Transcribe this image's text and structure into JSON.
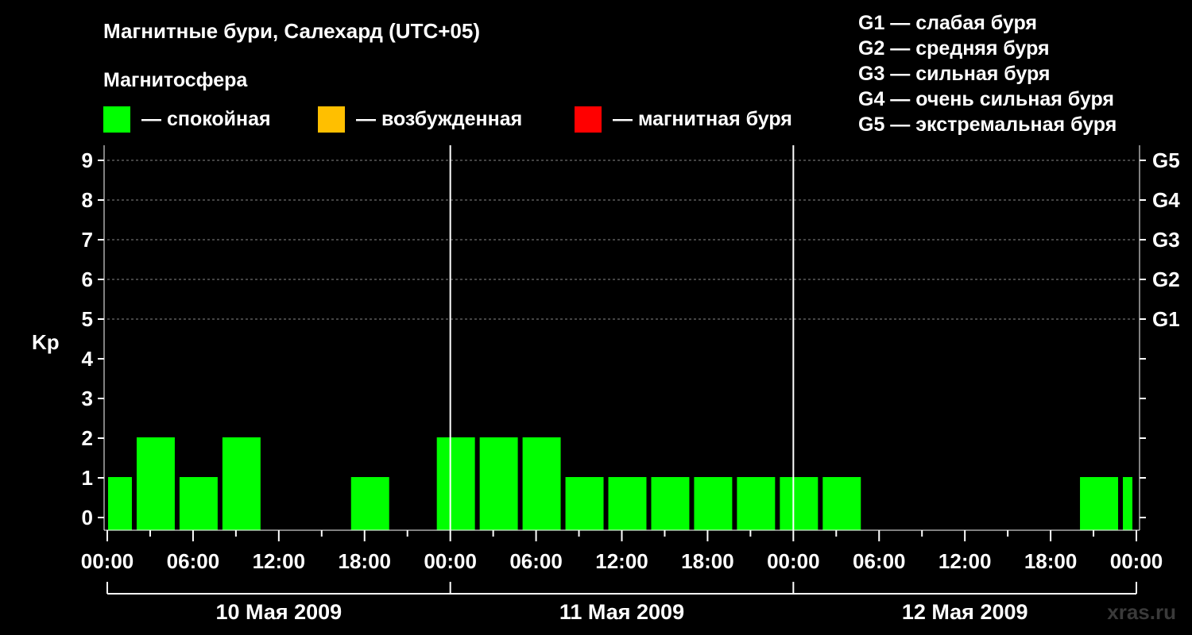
{
  "chart_data": {
    "type": "bar",
    "title": "Магнитные бури, Салехард (UTC+05)",
    "legend_title": "Магнитосфера",
    "legend": [
      {
        "label": "— спокойная",
        "color": "#00ff00"
      },
      {
        "label": "— возбужденная",
        "color": "#ffbf00"
      },
      {
        "label": "— магнитная буря",
        "color": "#ff0000"
      }
    ],
    "g_scale_legend": [
      "G1 — слабая буря",
      "G2 — средняя буря",
      "G3 — сильная буря",
      "G4 — очень сильная буря",
      "G5 — экстремальная буря"
    ],
    "ylabel": "Kp",
    "ylim": [
      0,
      9
    ],
    "y_ticks": [
      "0",
      "1",
      "2",
      "3",
      "4",
      "5",
      "6",
      "7",
      "8",
      "9"
    ],
    "right_axis_labels": [
      {
        "kp": 5,
        "label": "G1"
      },
      {
        "kp": 6,
        "label": "G2"
      },
      {
        "kp": 7,
        "label": "G3"
      },
      {
        "kp": 8,
        "label": "G4"
      },
      {
        "kp": 9,
        "label": "G5"
      }
    ],
    "x_tick_labels": [
      "00:00",
      "06:00",
      "12:00",
      "18:00",
      "00:00",
      "06:00",
      "12:00",
      "18:00",
      "00:00",
      "06:00",
      "12:00",
      "18:00",
      "00:00"
    ],
    "x_range_hours": [
      0,
      72
    ],
    "days": [
      "10 Мая 2009",
      "11 Мая 2009",
      "12 Мая 2009"
    ],
    "grid": true,
    "bars": [
      {
        "start_hour": 0,
        "end_hour": 2,
        "kp": 1,
        "color": "#00ff00"
      },
      {
        "start_hour": 2,
        "end_hour": 5,
        "kp": 2,
        "color": "#00ff00"
      },
      {
        "start_hour": 5,
        "end_hour": 8,
        "kp": 1,
        "color": "#00ff00"
      },
      {
        "start_hour": 8,
        "end_hour": 11,
        "kp": 2,
        "color": "#00ff00"
      },
      {
        "start_hour": 11,
        "end_hour": 14,
        "kp": 0,
        "color": "#00ff00"
      },
      {
        "start_hour": 14,
        "end_hour": 17,
        "kp": 0,
        "color": "#00ff00"
      },
      {
        "start_hour": 17,
        "end_hour": 20,
        "kp": 1,
        "color": "#00ff00"
      },
      {
        "start_hour": 20,
        "end_hour": 23,
        "kp": 0,
        "color": "#00ff00"
      },
      {
        "start_hour": 23,
        "end_hour": 26,
        "kp": 2,
        "color": "#00ff00"
      },
      {
        "start_hour": 26,
        "end_hour": 29,
        "kp": 2,
        "color": "#00ff00"
      },
      {
        "start_hour": 29,
        "end_hour": 32,
        "kp": 2,
        "color": "#00ff00"
      },
      {
        "start_hour": 32,
        "end_hour": 35,
        "kp": 1,
        "color": "#00ff00"
      },
      {
        "start_hour": 35,
        "end_hour": 38,
        "kp": 1,
        "color": "#00ff00"
      },
      {
        "start_hour": 38,
        "end_hour": 41,
        "kp": 1,
        "color": "#00ff00"
      },
      {
        "start_hour": 41,
        "end_hour": 44,
        "kp": 1,
        "color": "#00ff00"
      },
      {
        "start_hour": 44,
        "end_hour": 47,
        "kp": 1,
        "color": "#00ff00"
      },
      {
        "start_hour": 47,
        "end_hour": 50,
        "kp": 1,
        "color": "#00ff00"
      },
      {
        "start_hour": 50,
        "end_hour": 53,
        "kp": 1,
        "color": "#00ff00"
      },
      {
        "start_hour": 53,
        "end_hour": 56,
        "kp": 0,
        "color": "#00ff00"
      },
      {
        "start_hour": 56,
        "end_hour": 59,
        "kp": 0,
        "color": "#00ff00"
      },
      {
        "start_hour": 59,
        "end_hour": 62,
        "kp": 0,
        "color": "#00ff00"
      },
      {
        "start_hour": 62,
        "end_hour": 65,
        "kp": 0,
        "color": "#00ff00"
      },
      {
        "start_hour": 65,
        "end_hour": 68,
        "kp": 0,
        "color": "#00ff00"
      },
      {
        "start_hour": 68,
        "end_hour": 71,
        "kp": 1,
        "color": "#00ff00"
      },
      {
        "start_hour": 71,
        "end_hour": 72,
        "kp": 1,
        "color": "#00ff00"
      }
    ]
  },
  "watermark": "xras.ru"
}
